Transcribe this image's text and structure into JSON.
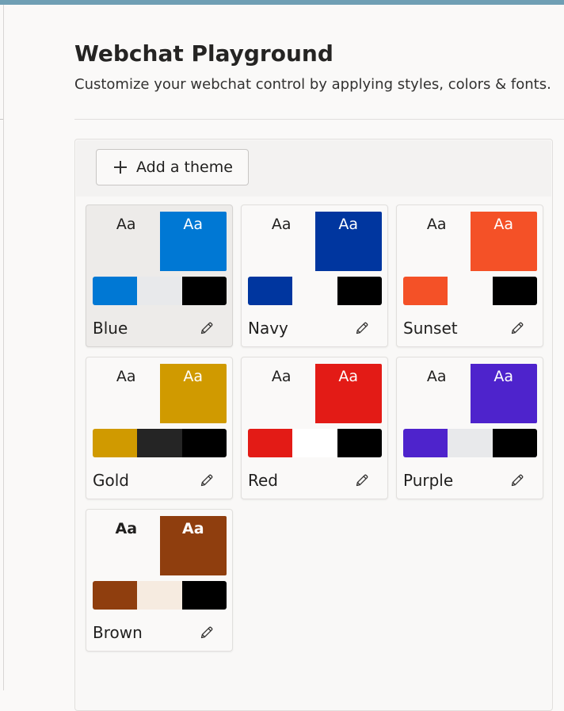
{
  "header": {
    "title": "Webchat Playground",
    "subtitle": "Customize your webchat control by applying styles, colors & fonts."
  },
  "toolbar": {
    "add_theme_label": "Add a theme",
    "add_icon": "plus-icon"
  },
  "themes": [
    {
      "name": "Blue",
      "selected": true,
      "preview_label": "Aa",
      "font": "sans",
      "preview_left_bg": "#edebe9",
      "preview_left_fg": "#201f1e",
      "preview_right_bg": "#0078d4",
      "preview_right_fg": "#ffffff",
      "swatches": [
        "#0078d4",
        "#e8e9eb",
        "#000000"
      ],
      "edit_icon": "pencil-icon"
    },
    {
      "name": "Navy",
      "selected": false,
      "preview_label": "Aa",
      "font": "mono",
      "preview_left_bg": "#faf9f8",
      "preview_left_fg": "#201f1e",
      "preview_right_bg": "#00369f",
      "preview_right_fg": "#ffffff",
      "swatches": [
        "#00369f",
        "#faf9f8",
        "#000000"
      ],
      "edit_icon": "pencil-icon"
    },
    {
      "name": "Sunset",
      "selected": false,
      "preview_label": "Aa",
      "font": "sans",
      "preview_left_bg": "#faf9f8",
      "preview_left_fg": "#201f1e",
      "preview_right_bg": "#f45127",
      "preview_right_fg": "#ffffff",
      "swatches": [
        "#f45127",
        "#faf9f8",
        "#000000"
      ],
      "edit_icon": "pencil-icon"
    },
    {
      "name": "Gold",
      "selected": false,
      "preview_label": "Aa",
      "font": "sans",
      "preview_left_bg": "#faf9f8",
      "preview_left_fg": "#201f1e",
      "preview_right_bg": "#d09a00",
      "preview_right_fg": "#ffffff",
      "swatches": [
        "#d09a00",
        "#252525",
        "#000000"
      ],
      "edit_icon": "pencil-icon"
    },
    {
      "name": "Red",
      "selected": false,
      "preview_label": "Aa",
      "font": "sans",
      "preview_left_bg": "#faf9f8",
      "preview_left_fg": "#201f1e",
      "preview_right_bg": "#e31b16",
      "preview_right_fg": "#ffffff",
      "swatches": [
        "#e31b16",
        "#ffffff",
        "#000000"
      ],
      "edit_icon": "pencil-icon"
    },
    {
      "name": "Purple",
      "selected": false,
      "preview_label": "Aa",
      "font": "sans",
      "preview_left_bg": "#faf9f8",
      "preview_left_fg": "#201f1e",
      "preview_right_bg": "#4e23cc",
      "preview_right_fg": "#ffffff",
      "swatches": [
        "#4e23cc",
        "#e8e9eb",
        "#000000"
      ],
      "edit_icon": "pencil-icon"
    },
    {
      "name": "Brown",
      "selected": false,
      "preview_label": "Aa",
      "font": "sans-bold",
      "preview_left_bg": "#faf9f8",
      "preview_left_fg": "#201f1e",
      "preview_right_bg": "#8f3e0e",
      "preview_right_fg": "#ffffff",
      "swatches": [
        "#8f3e0e",
        "#f6ebe0",
        "#000000"
      ],
      "edit_icon": "pencil-icon"
    }
  ]
}
